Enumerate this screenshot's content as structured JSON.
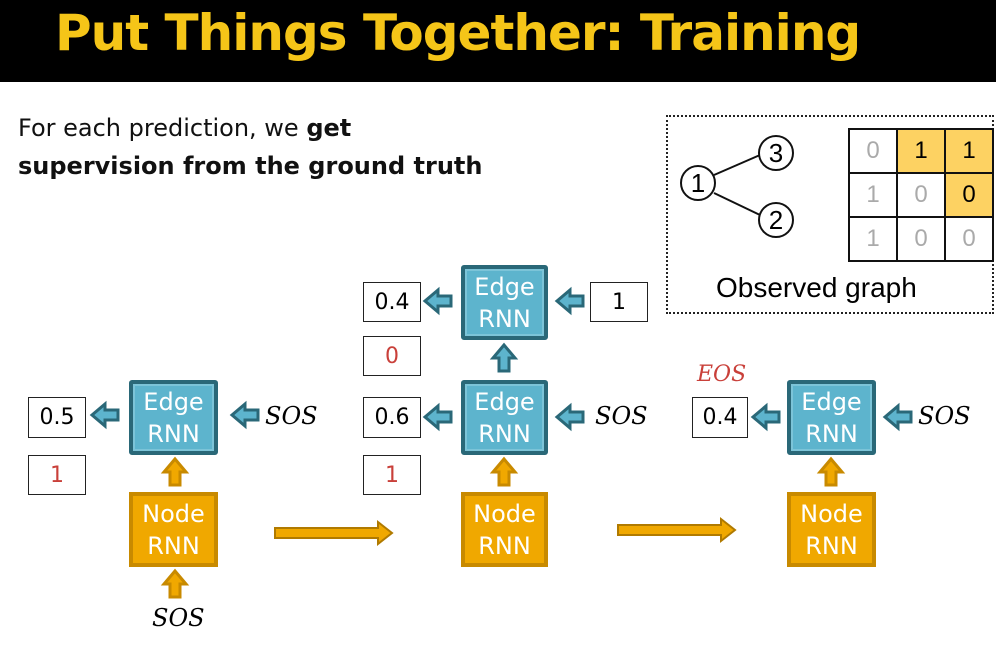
{
  "title": "Put Things Together: Training",
  "intro": {
    "line1_normal": "For each prediction, we ",
    "line1_bold": "get",
    "line2_bold": "supervision from the ground truth"
  },
  "observed_graph": {
    "label": "Observed graph",
    "nodes": [
      "1",
      "2",
      "3"
    ],
    "edges": [
      [
        "1",
        "3"
      ],
      [
        "1",
        "2"
      ]
    ],
    "matrix": [
      [
        "0",
        "1",
        "1"
      ],
      [
        "1",
        "0",
        "0"
      ],
      [
        "1",
        "0",
        "0"
      ]
    ],
    "highlight_color": "#fdd262"
  },
  "blocks": {
    "edge_rnn": [
      "Edge",
      "RNN"
    ],
    "node_rnn": [
      "Node",
      "RNN"
    ],
    "sos": "SOS",
    "eos": "EOS"
  },
  "step1": {
    "pred": "0.5",
    "truth": "1"
  },
  "step2": {
    "pred_top": "0.4",
    "truth_top": "0",
    "input_top": "1",
    "pred": "0.6",
    "truth": "1"
  },
  "step3": {
    "pred": "0.4"
  },
  "colors": {
    "edge_rnn": "#5db4cd",
    "node_rnn": "#f0a800",
    "title": "#f5c518",
    "truth": "#c9403a"
  }
}
